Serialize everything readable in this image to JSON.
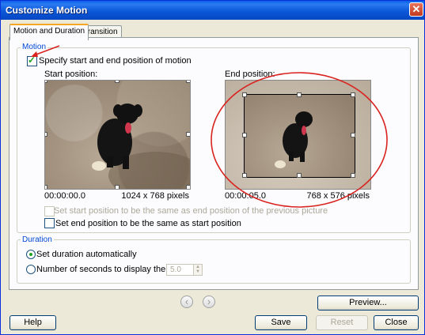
{
  "window": {
    "title": "Customize Motion",
    "close_glyph": "✕"
  },
  "tabs": [
    {
      "label": "Motion and Duration",
      "active": true
    },
    {
      "label": "Transition",
      "active": false
    }
  ],
  "motion": {
    "group_label": "Motion",
    "specify_label": "Specify start and end position of motion",
    "specify_checked": true,
    "start_label": "Start position:",
    "end_label": "End position:",
    "start_time": "00:00:00.0",
    "start_size": "1024 x 768 pixels",
    "end_time": "00:00:05.0",
    "end_size": "768 x 576 pixels",
    "same_as_prev_label": "Set start position to be the same as end position of the previous picture",
    "same_as_prev_enabled": false,
    "end_same_as_start_label": "Set end position to be the same as start position",
    "end_same_as_start_checked": false
  },
  "duration": {
    "group_label": "Duration",
    "auto_label": "Set duration automatically",
    "auto_selected": true,
    "seconds_label": "Number of seconds to display the picture",
    "seconds_value": "5.0"
  },
  "buttons": {
    "preview": "Preview...",
    "help": "Help",
    "save": "Save",
    "reset": "Reset",
    "close": "Close",
    "prev_glyph": "‹",
    "next_glyph": "›"
  },
  "icons": {
    "checkmark": "✓",
    "spin_up": "▲",
    "spin_down": "▼"
  },
  "annotation": {
    "arrow_color": "#d9231f",
    "ellipse_color": "#d9231f"
  }
}
